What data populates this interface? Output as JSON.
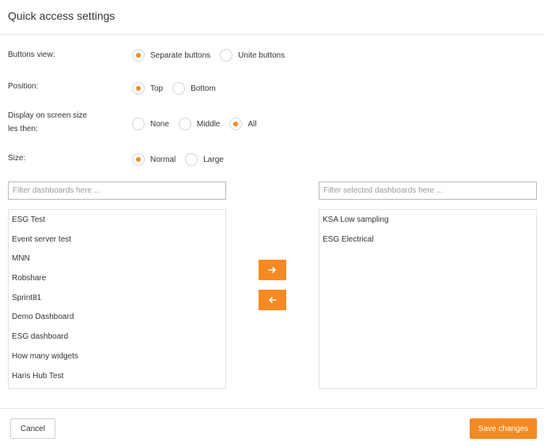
{
  "dialog": {
    "title": "Quick access settings"
  },
  "settings": {
    "buttons_view": {
      "label": "Buttons view:",
      "options": [
        "Separate buttons",
        "Unite buttons"
      ],
      "selected": "Separate buttons"
    },
    "position": {
      "label": "Position:",
      "options": [
        "Top",
        "Bottom"
      ],
      "selected": "Top"
    },
    "display_on_screen": {
      "label_line1": "Display on screen size",
      "label_line2": "les then:",
      "options": [
        "None",
        "Middle",
        "All"
      ],
      "selected": "All"
    },
    "size": {
      "label": "Size:",
      "options": [
        "Normal",
        "Large"
      ],
      "selected": "Normal"
    }
  },
  "available": {
    "filter_placeholder": "Filter dashboards here ...",
    "items": [
      "ESG Test",
      "Event server test",
      "MNN",
      "Robshare",
      "Sprint81",
      "Demo Dashboard",
      "ESG dashboard",
      "How many widgets",
      "Haris Hub Test"
    ]
  },
  "selected": {
    "filter_placeholder": "Filter selected dashboards here ...",
    "items": [
      "KSA Low sampling",
      "ESG Electrical"
    ]
  },
  "icons": {
    "move_right": "arrow-right-icon",
    "move_left": "arrow-left-icon"
  },
  "footer": {
    "cancel_label": "Cancel",
    "save_label": "Save changes"
  },
  "colors": {
    "accent": "#f58a22",
    "text": "#333333",
    "border": "#e2e2e2"
  }
}
